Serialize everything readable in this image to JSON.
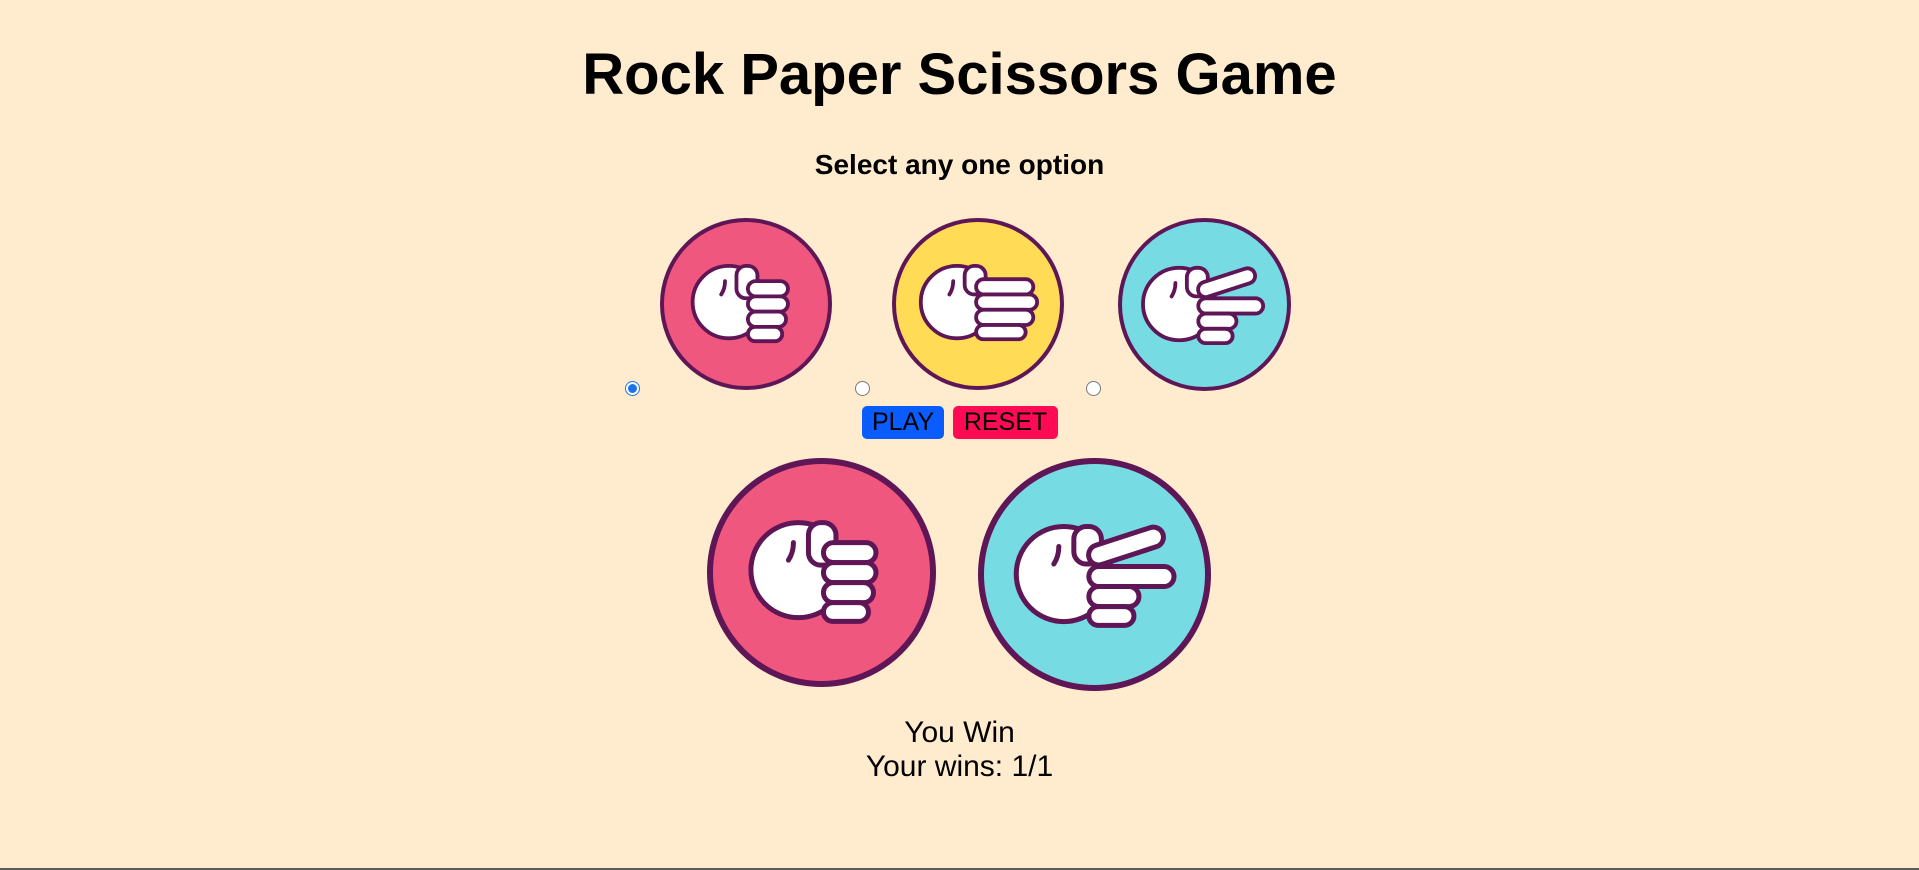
{
  "title": "Rock Paper Scissors Game",
  "subtitle": "Select any one option",
  "choices": [
    {
      "name": "rock",
      "icon": "rock-fist-icon",
      "color": "#f0577f",
      "selected": true
    },
    {
      "name": "paper",
      "icon": "paper-hand-icon",
      "color": "#ffdb56",
      "selected": false
    },
    {
      "name": "scissors",
      "icon": "scissors-hand-icon",
      "color": "#77dbe3",
      "selected": false
    }
  ],
  "buttons": {
    "play_label": "PLAY",
    "play_color": "#0a5cff",
    "reset_label": "RESET",
    "reset_color": "#ff0a54"
  },
  "result": {
    "player_choice": "rock",
    "computer_choice": "scissors",
    "message": "You Win",
    "wins_text": "Your wins: 1/1"
  },
  "colors": {
    "background": "#ffebcd",
    "outline": "#5e1656",
    "hand_fill": "#ffffff"
  }
}
